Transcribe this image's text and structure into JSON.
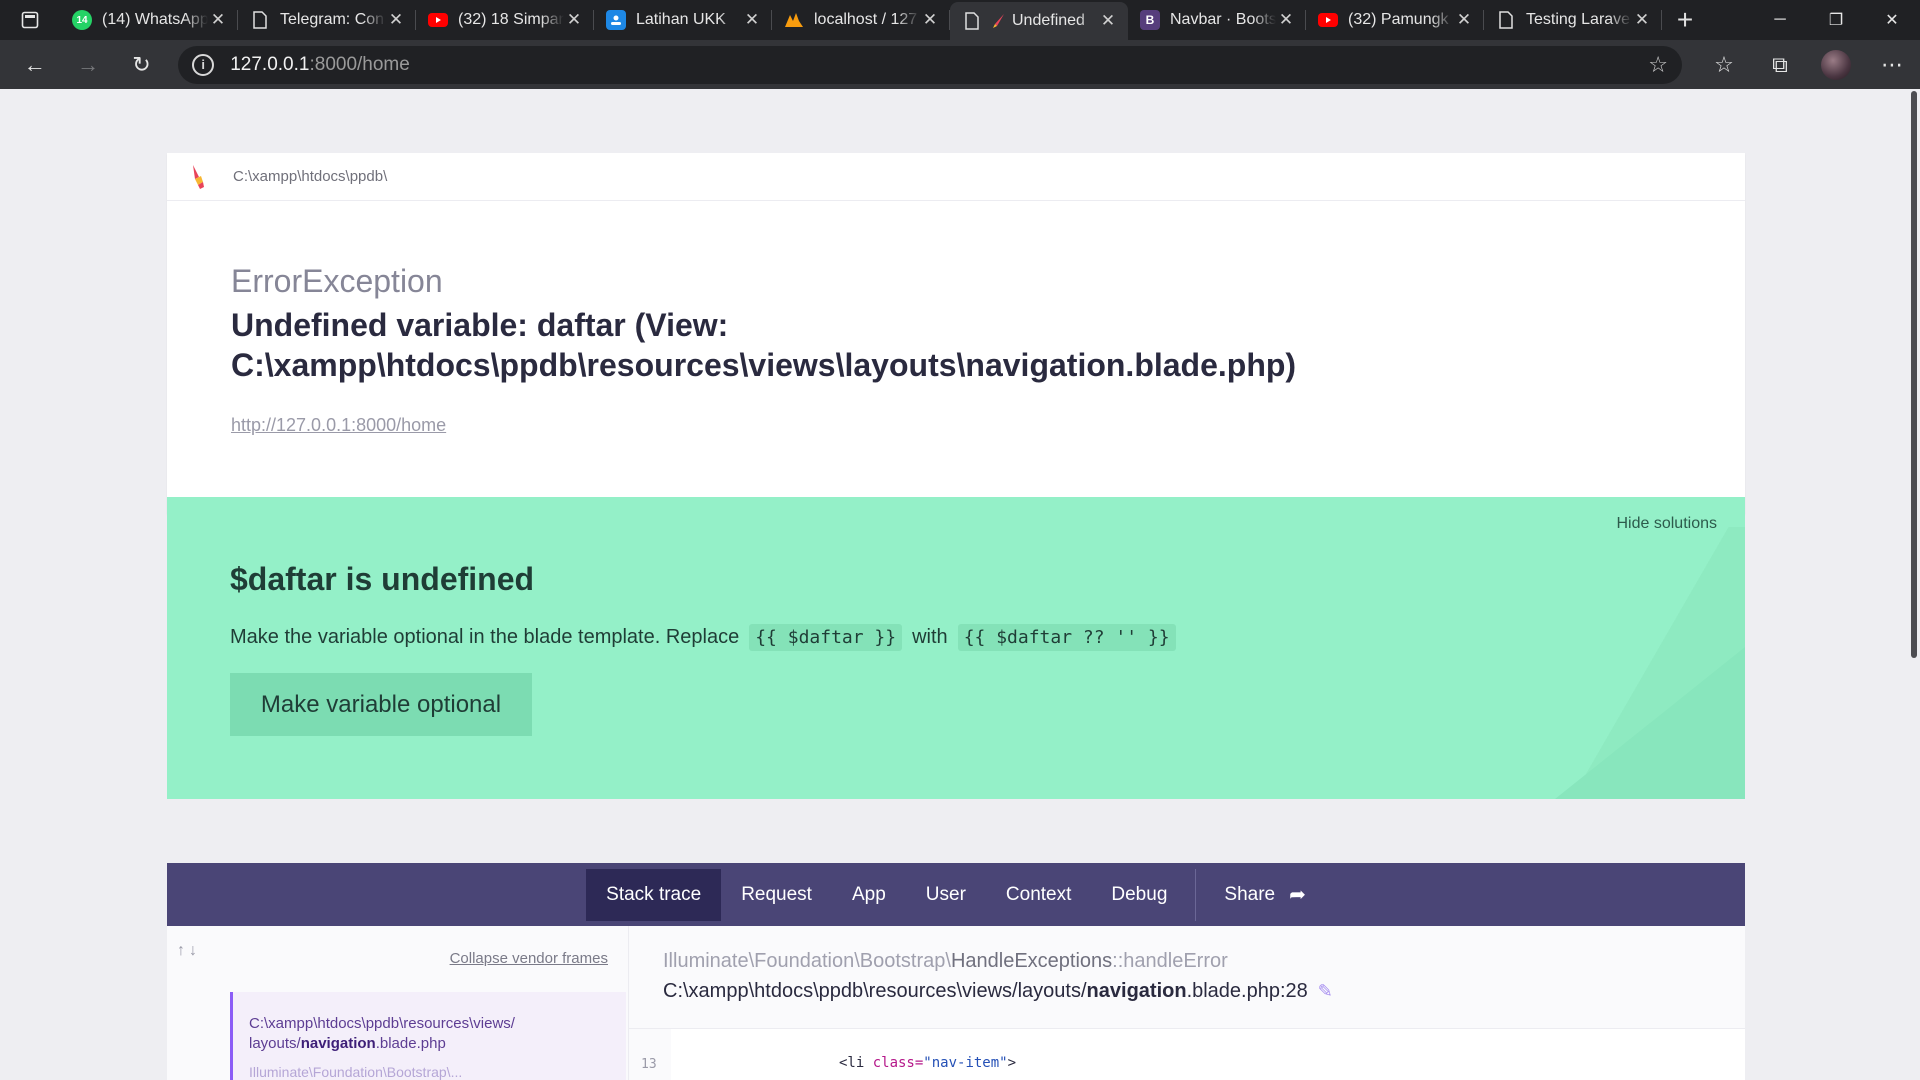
{
  "browser": {
    "tabs": [
      {
        "title": "(14) WhatsApp",
        "icon": "whatsapp-icon",
        "badge": "14",
        "active": false
      },
      {
        "title": "Telegram: Con",
        "icon": "document-icon",
        "active": false
      },
      {
        "title": "(32) 18 Simpan",
        "icon": "youtube-icon",
        "active": false
      },
      {
        "title": "Latihan UKK",
        "icon": "classroom-icon",
        "active": false
      },
      {
        "title": "localhost / 127",
        "icon": "phpmyadmin-icon",
        "active": false
      },
      {
        "title": "Undefined",
        "icon": "document-icon",
        "active": true
      },
      {
        "title": "Navbar · Boots",
        "icon": "bootstrap-icon",
        "active": false
      },
      {
        "title": "(32) Pamungk",
        "icon": "youtube-icon",
        "active": false
      },
      {
        "title": "Testing Larave",
        "icon": "document-icon",
        "active": false
      }
    ],
    "address": {
      "host": "127.0.0.1",
      "rest": ":8000/home"
    }
  },
  "error": {
    "project_path": "C:\\xampp\\htdocs\\ppdb\\",
    "exception_class": "ErrorException",
    "message": "Undefined variable: daftar (View: C:\\xampp\\htdocs\\ppdb\\resources\\views\\layouts\\navigation.blade.php)",
    "url": "http://127.0.0.1:8000/home"
  },
  "solution": {
    "hide_label": "Hide solutions",
    "title": "$daftar is undefined",
    "desc_prefix": "Make the variable optional in the blade template. Replace",
    "code_from": "{{ $daftar }}",
    "desc_with": "with",
    "code_to": "{{ $daftar ?? '' }}",
    "button_label": "Make variable optional"
  },
  "tabs": {
    "stack_trace": "Stack trace",
    "request": "Request",
    "app": "App",
    "user": "User",
    "context": "Context",
    "debug": "Debug",
    "share": "Share"
  },
  "stack": {
    "collapse_label": "Collapse vendor frames",
    "frame_path_prefix": "C:\\xampp\\htdocs\\ppdb\\resources\\views/ layouts/",
    "frame_path_bold": "navigation",
    "frame_path_suffix": ".blade.php",
    "frame_next": "Illuminate\\Foundation\\Bootstrap\\...",
    "frame_namespace": "Illuminate\\Foundation\\Bootstrap\\",
    "frame_class": "HandleExceptions",
    "frame_method": "::handleError",
    "file_prefix": "C:\\xampp\\htdocs\\ppdb\\resources\\views/layouts/",
    "file_bold": "navigation",
    "file_suffix": ".blade.php:28",
    "code_line_number": "13",
    "code_tag_open": "<li ",
    "code_attr": "class=",
    "code_value": "\"nav-item\"",
    "code_tag_close": ">"
  },
  "colors": {
    "solution_bg": "#94f0c8",
    "tabs_bg": "#4a4576",
    "active_tab_bg": "#2d2956",
    "frame_accent": "#8b5cf6"
  }
}
